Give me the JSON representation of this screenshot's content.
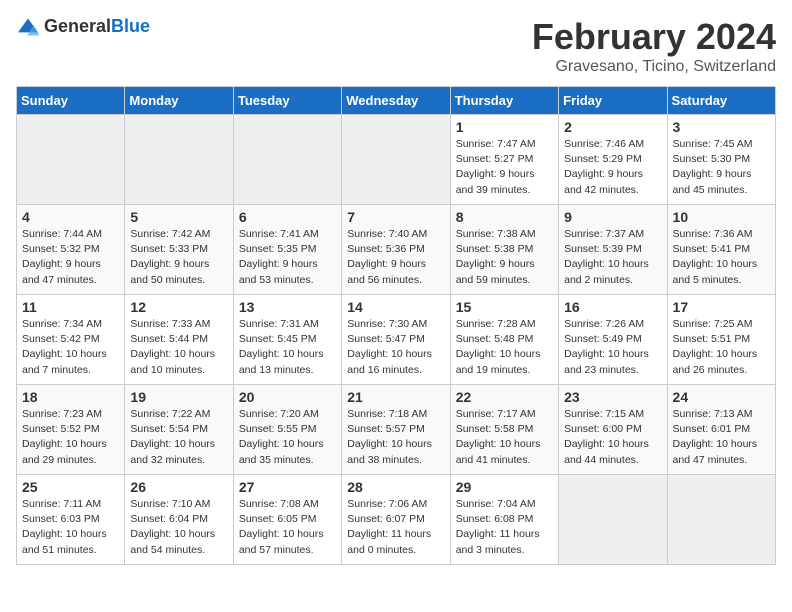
{
  "header": {
    "logo_general": "General",
    "logo_blue": "Blue",
    "month_year": "February 2024",
    "location": "Gravesano, Ticino, Switzerland"
  },
  "days_of_week": [
    "Sunday",
    "Monday",
    "Tuesday",
    "Wednesday",
    "Thursday",
    "Friday",
    "Saturday"
  ],
  "weeks": [
    [
      {
        "day": "",
        "empty": true
      },
      {
        "day": "",
        "empty": true
      },
      {
        "day": "",
        "empty": true
      },
      {
        "day": "",
        "empty": true
      },
      {
        "day": "1",
        "sunrise": "Sunrise: 7:47 AM",
        "sunset": "Sunset: 5:27 PM",
        "daylight": "Daylight: 9 hours and 39 minutes."
      },
      {
        "day": "2",
        "sunrise": "Sunrise: 7:46 AM",
        "sunset": "Sunset: 5:29 PM",
        "daylight": "Daylight: 9 hours and 42 minutes."
      },
      {
        "day": "3",
        "sunrise": "Sunrise: 7:45 AM",
        "sunset": "Sunset: 5:30 PM",
        "daylight": "Daylight: 9 hours and 45 minutes."
      }
    ],
    [
      {
        "day": "4",
        "sunrise": "Sunrise: 7:44 AM",
        "sunset": "Sunset: 5:32 PM",
        "daylight": "Daylight: 9 hours and 47 minutes."
      },
      {
        "day": "5",
        "sunrise": "Sunrise: 7:42 AM",
        "sunset": "Sunset: 5:33 PM",
        "daylight": "Daylight: 9 hours and 50 minutes."
      },
      {
        "day": "6",
        "sunrise": "Sunrise: 7:41 AM",
        "sunset": "Sunset: 5:35 PM",
        "daylight": "Daylight: 9 hours and 53 minutes."
      },
      {
        "day": "7",
        "sunrise": "Sunrise: 7:40 AM",
        "sunset": "Sunset: 5:36 PM",
        "daylight": "Daylight: 9 hours and 56 minutes."
      },
      {
        "day": "8",
        "sunrise": "Sunrise: 7:38 AM",
        "sunset": "Sunset: 5:38 PM",
        "daylight": "Daylight: 9 hours and 59 minutes."
      },
      {
        "day": "9",
        "sunrise": "Sunrise: 7:37 AM",
        "sunset": "Sunset: 5:39 PM",
        "daylight": "Daylight: 10 hours and 2 minutes."
      },
      {
        "day": "10",
        "sunrise": "Sunrise: 7:36 AM",
        "sunset": "Sunset: 5:41 PM",
        "daylight": "Daylight: 10 hours and 5 minutes."
      }
    ],
    [
      {
        "day": "11",
        "sunrise": "Sunrise: 7:34 AM",
        "sunset": "Sunset: 5:42 PM",
        "daylight": "Daylight: 10 hours and 7 minutes."
      },
      {
        "day": "12",
        "sunrise": "Sunrise: 7:33 AM",
        "sunset": "Sunset: 5:44 PM",
        "daylight": "Daylight: 10 hours and 10 minutes."
      },
      {
        "day": "13",
        "sunrise": "Sunrise: 7:31 AM",
        "sunset": "Sunset: 5:45 PM",
        "daylight": "Daylight: 10 hours and 13 minutes."
      },
      {
        "day": "14",
        "sunrise": "Sunrise: 7:30 AM",
        "sunset": "Sunset: 5:47 PM",
        "daylight": "Daylight: 10 hours and 16 minutes."
      },
      {
        "day": "15",
        "sunrise": "Sunrise: 7:28 AM",
        "sunset": "Sunset: 5:48 PM",
        "daylight": "Daylight: 10 hours and 19 minutes."
      },
      {
        "day": "16",
        "sunrise": "Sunrise: 7:26 AM",
        "sunset": "Sunset: 5:49 PM",
        "daylight": "Daylight: 10 hours and 23 minutes."
      },
      {
        "day": "17",
        "sunrise": "Sunrise: 7:25 AM",
        "sunset": "Sunset: 5:51 PM",
        "daylight": "Daylight: 10 hours and 26 minutes."
      }
    ],
    [
      {
        "day": "18",
        "sunrise": "Sunrise: 7:23 AM",
        "sunset": "Sunset: 5:52 PM",
        "daylight": "Daylight: 10 hours and 29 minutes."
      },
      {
        "day": "19",
        "sunrise": "Sunrise: 7:22 AM",
        "sunset": "Sunset: 5:54 PM",
        "daylight": "Daylight: 10 hours and 32 minutes."
      },
      {
        "day": "20",
        "sunrise": "Sunrise: 7:20 AM",
        "sunset": "Sunset: 5:55 PM",
        "daylight": "Daylight: 10 hours and 35 minutes."
      },
      {
        "day": "21",
        "sunrise": "Sunrise: 7:18 AM",
        "sunset": "Sunset: 5:57 PM",
        "daylight": "Daylight: 10 hours and 38 minutes."
      },
      {
        "day": "22",
        "sunrise": "Sunrise: 7:17 AM",
        "sunset": "Sunset: 5:58 PM",
        "daylight": "Daylight: 10 hours and 41 minutes."
      },
      {
        "day": "23",
        "sunrise": "Sunrise: 7:15 AM",
        "sunset": "Sunset: 6:00 PM",
        "daylight": "Daylight: 10 hours and 44 minutes."
      },
      {
        "day": "24",
        "sunrise": "Sunrise: 7:13 AM",
        "sunset": "Sunset: 6:01 PM",
        "daylight": "Daylight: 10 hours and 47 minutes."
      }
    ],
    [
      {
        "day": "25",
        "sunrise": "Sunrise: 7:11 AM",
        "sunset": "Sunset: 6:03 PM",
        "daylight": "Daylight: 10 hours and 51 minutes."
      },
      {
        "day": "26",
        "sunrise": "Sunrise: 7:10 AM",
        "sunset": "Sunset: 6:04 PM",
        "daylight": "Daylight: 10 hours and 54 minutes."
      },
      {
        "day": "27",
        "sunrise": "Sunrise: 7:08 AM",
        "sunset": "Sunset: 6:05 PM",
        "daylight": "Daylight: 10 hours and 57 minutes."
      },
      {
        "day": "28",
        "sunrise": "Sunrise: 7:06 AM",
        "sunset": "Sunset: 6:07 PM",
        "daylight": "Daylight: 11 hours and 0 minutes."
      },
      {
        "day": "29",
        "sunrise": "Sunrise: 7:04 AM",
        "sunset": "Sunset: 6:08 PM",
        "daylight": "Daylight: 11 hours and 3 minutes."
      },
      {
        "day": "",
        "empty": true
      },
      {
        "day": "",
        "empty": true
      }
    ]
  ]
}
